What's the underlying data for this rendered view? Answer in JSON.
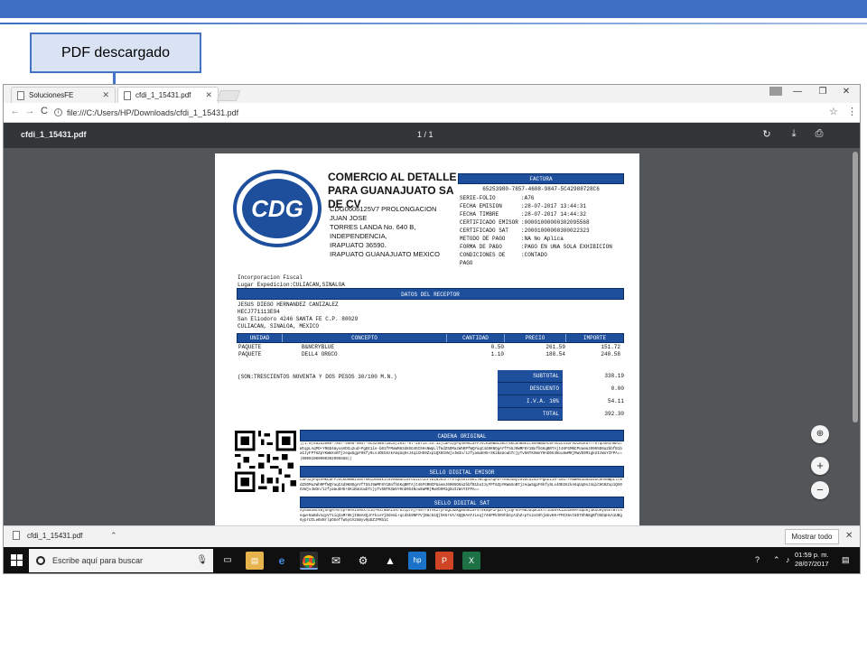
{
  "slide": {
    "callout_label": "PDF descargado"
  },
  "browser": {
    "tabs": [
      {
        "label": "SolucionesFE",
        "active": false
      },
      {
        "label": "cfdi_1_15431.pdf",
        "active": true
      }
    ],
    "url": "file:///C:/Users/HP/Downloads/cfdi_1_15431.pdf"
  },
  "pdf_viewer": {
    "file_name": "cfdi_1_15431.pdf",
    "page_indicator": "1 / 1"
  },
  "invoice": {
    "company_name": "COMERCIO AL DETALLE PARA GUANAJUATO SA DE CV",
    "company_address": [
      "CDG0606125V7 PROLONGACION JUAN JOSE",
      "TORRES LANDA No. 640 B, INDEPENDENCIA,",
      "IRAPUATO 36590.",
      "IRAPUATO GUANAJUATO MEXICO"
    ],
    "logo_text": "CDG",
    "factura_title": "FACTURA",
    "uuid": "65253980-7857-4608-9847-5C42988728C6",
    "fields": [
      {
        "k": "SERIE-FOLIO",
        "v": ":A76"
      },
      {
        "k": "FECHA EMISION",
        "v": ":28-07-2017 13:44:31"
      },
      {
        "k": "FECHA TIMBRE",
        "v": ":28-07-2017 14:44:32"
      },
      {
        "k": "CERTIFICADO EMISOR",
        "v": ":00001000000302095568"
      },
      {
        "k": "CERTIFICADO SAT",
        "v": ":20001000000300022323"
      },
      {
        "k": "METODO DE PAGO",
        "v": ":NA No Aplica"
      },
      {
        "k": "FORMA DE PAGO",
        "v": ":PAGO EN UNA SOLA EXHIBICION"
      },
      {
        "k": "CONDICIONES DE PAGO",
        "v": ":CONTADO"
      }
    ],
    "regimen": "Incorporacion Fiscal",
    "lugar": "Lugar Expedicion:CULIACAN,SINALOA",
    "receptor_title": "DATOS DEL RECEPTOR",
    "receptor_lines": [
      "JESUS DIEGO HERNANDEZ CANIZALEZ",
      "HECJ771113E94",
      "San Eliodoro 4246 SANTA FE C.P. 80029",
      "CULIACAN, SINALOA, MEXICO"
    ],
    "columns": [
      "UNIDAD",
      "CONCEPTO",
      "CANTIDAD",
      "PRECIO",
      "IMPORTE"
    ],
    "items": [
      {
        "unidad": "PAQUETE",
        "concepto": "B&NCRYBLUE",
        "cantidad": "0.50",
        "precio": "261.59",
        "importe": "151.72"
      },
      {
        "unidad": "PAQUETE",
        "concepto": "DELL4 ORGCO",
        "cantidad": "1.10",
        "precio": "188.54",
        "importe": "240.58"
      }
    ],
    "importe_letra": "(SON:TRESCIENTOS NOVENTA Y DOS PESOS 30/100 M.N.)",
    "totals": [
      {
        "label": "SUBTOTAL",
        "value": "338.19"
      },
      {
        "label": "DESCUENTO",
        "value": "0.00"
      },
      {
        "label": "I.V.A. 16%",
        "value": "54.11"
      },
      {
        "label": "TOTAL",
        "value": "392.30"
      }
    ],
    "cadena_title": "CADENA ORIGINAL",
    "cadena_text": "||1.0|65253980-7857-4608-9847-5C42988728C6|2017-07-28T14:44:32|CaPJ2yPq4eMKCaFPJVCKDRWmIS0oT6KCDhmakIt8vHNmaAc8FoG1Lo1GFVDiNJkdf/r0TqoXRIn0R17WtqpLAqPD+YR6D4myvaVDCu2ud+PgEE1ie-b01fFMaWM83d8SG4GC9HsNWpLlfmdZ5DMazWhRPfWQYaqC4d9KNOgAYfT55J9WMF8Y1BnfhGKqBRTAjt46FGMNCPUaemJ0005D0a2bbfB1baIJyFPT6ZpYKWmXoBTjzeqwSgpF0kfy9Ls4OEG6zkA6qUq9sJ4qiCHG0Zxp1QX0GVWjvJW3n/1zfyamuEH5+SKiBaUcwbTcjyTv5NTKXWnY0nD0G4Nou8wMRjMwVD9M1gkUIzWoYIFPA==|00001000000302095568||",
    "sello_emisor_title": "SELLO DIGITAL EMISOR",
    "sello_emisor_text": "CaPJ2yPq4eMKCaFPJVCKDRWmIS0oT6KCDhmakIt8vHNmaAc8FoG1Lo1GFVDiNJkdf/r0TqoXRIn0R17WtqpLAqPD+YR6D4myvaVDCu2ud+PgEE1ie-b01fFMaWM83d8SG4GC9HsNWpLlfmdZ5DMazWhRPfWQYaqC4d9KNOgAYfT55J9WMF8Y1BnfhGKqBRTAjt46FGMNCPUaemJ0005D0a2bbfB1baIJyFPT6ZpYKWmXoBTjzeqwSgpF0kfy9Ls4OEG6zkA6qUq9sJ4qiCHG0Zxp1QX0GVWjvJW3n/1zfyamuEH5+SKiBaUcwbTcjyTv5NTKXWnY0nD0G4Nou8wMRjMwVD9M1gkUIzWoYIFPA==",
    "sello_sat_title": "SELLO DIGITAL SAT",
    "sello_sat_text": "XyOaaSmt4BjShgM7NfEp+8enIoRhX7IiG+KSfWaAI5n/8JIp/Hj+49fFaYsk2TyFbgLaZKgmdOKiaFv70kNpP1FpZfVjIQF5u+MBJUqaCkkY7JD6NYKi2CGHRM+aqGRj3KSOHyu5hTWTtHeqw+NaBdvnqyV71iqIaMrHKjI0mAXQJrFkLeYjDdemi+qcdSk9NP7VjBmc61QjhK5rVA/XQQHAAFJLeqj74KPPkhRVhbGyA1hZ+pTx2xG9hjmGvK0+FMtX6vt8D7OhN8gBfOSDqHsA1UBg6yprUILeBvBrlpOGeffw5yGA2m8yv0pDZJPRb1C"
  },
  "downloads": {
    "file_name": "cfdi_1_15431.pdf",
    "show_all": "Mostrar todo"
  },
  "taskbar": {
    "search_placeholder": "Escribe aquí para buscar",
    "time": "01:59 p. m.",
    "date": "28/07/2017"
  },
  "colors": {
    "slide_accent": "#3e6fc4",
    "invoice_blue": "#1d4f9d",
    "pdf_toolbar": "#323639",
    "pdf_background": "#525659"
  }
}
